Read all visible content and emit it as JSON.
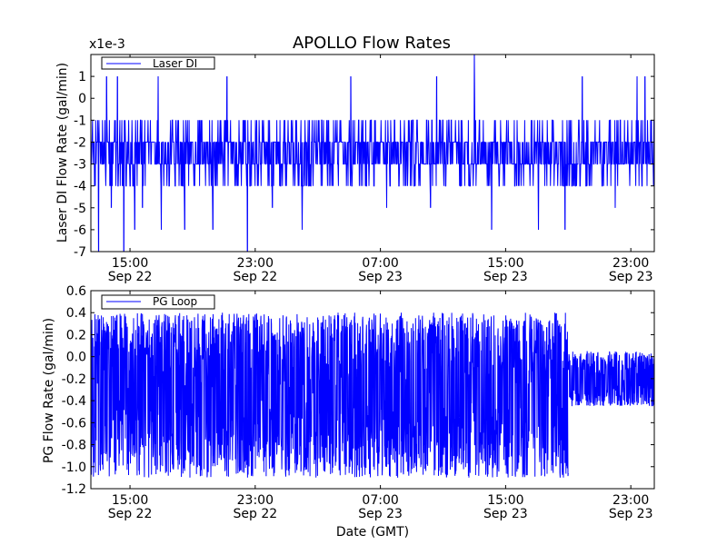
{
  "chart_data": [
    {
      "type": "line",
      "title": "APOLLO Flow Rates",
      "ylabel": "Laser DI Flow Rate (gal/min)",
      "y_multiplier": "x1e-3",
      "ylim": [
        -7,
        2
      ],
      "yticks": [
        "-7",
        "-6",
        "-5",
        "-4",
        "-3",
        "-2",
        "-1",
        "0",
        "1"
      ],
      "xticks": [
        {
          "time": "15:00",
          "date": "Sep 22"
        },
        {
          "time": "23:00",
          "date": "Sep 22"
        },
        {
          "time": "07:00",
          "date": "Sep 23"
        },
        {
          "time": "15:00",
          "date": "Sep 23"
        },
        {
          "time": "23:00",
          "date": "Sep 23"
        }
      ],
      "x_range_hours_from_first_tick": [
        -2.5,
        33.5
      ],
      "legend": "top-left",
      "color": "#0000ff",
      "series": [
        {
          "name": "Laser DI",
          "baseline_band": [
            -3,
            -2
          ],
          "typical_range": [
            -4,
            -1
          ],
          "spikes": [
            {
              "t": -2.0,
              "y": -7
            },
            {
              "t": -1.5,
              "y": 1
            },
            {
              "t": -1.2,
              "y": -5
            },
            {
              "t": -0.8,
              "y": 1
            },
            {
              "t": -0.4,
              "y": -7
            },
            {
              "t": 0.3,
              "y": -6
            },
            {
              "t": 0.8,
              "y": -5
            },
            {
              "t": 1.8,
              "y": 1
            },
            {
              "t": 2.0,
              "y": -6
            },
            {
              "t": 3.5,
              "y": -6
            },
            {
              "t": 5.3,
              "y": -6
            },
            {
              "t": 6.2,
              "y": 1
            },
            {
              "t": 7.5,
              "y": -7
            },
            {
              "t": 9.1,
              "y": -5
            },
            {
              "t": 11.0,
              "y": -6
            },
            {
              "t": 14.1,
              "y": 1
            },
            {
              "t": 16.4,
              "y": -5
            },
            {
              "t": 19.2,
              "y": -5
            },
            {
              "t": 19.6,
              "y": 1
            },
            {
              "t": 22.0,
              "y": 2
            },
            {
              "t": 23.1,
              "y": -6
            },
            {
              "t": 26.1,
              "y": -6
            },
            {
              "t": 27.8,
              "y": -6
            },
            {
              "t": 28.9,
              "y": 1
            },
            {
              "t": 31.0,
              "y": -5
            },
            {
              "t": 32.4,
              "y": 1
            },
            {
              "t": 32.9,
              "y": 1
            }
          ]
        }
      ]
    },
    {
      "type": "line",
      "ylabel": "PG Flow Rate (gal/min)",
      "xlabel": "Date (GMT)",
      "ylim": [
        -1.2,
        0.6
      ],
      "yticks": [
        "-1.2",
        "-1.0",
        "-0.8",
        "-0.6",
        "-0.4",
        "-0.2",
        "0.0",
        "0.2",
        "0.4",
        "0.6"
      ],
      "xticks": [
        {
          "time": "15:00",
          "date": "Sep 22"
        },
        {
          "time": "23:00",
          "date": "Sep 22"
        },
        {
          "time": "07:00",
          "date": "Sep 23"
        },
        {
          "time": "15:00",
          "date": "Sep 23"
        },
        {
          "time": "23:00",
          "date": "Sep 23"
        }
      ],
      "x_range_hours_from_first_tick": [
        -2.5,
        33.5
      ],
      "legend": "top-left",
      "color": "#0000ff",
      "series": [
        {
          "name": "PG Loop",
          "segments": [
            {
              "t_start": -2.5,
              "t_end": 28.0,
              "low": -1.1,
              "high": 0.4
            },
            {
              "t_start": 28.0,
              "t_end": 33.5,
              "low": -0.45,
              "high": 0.05
            }
          ]
        }
      ]
    }
  ]
}
